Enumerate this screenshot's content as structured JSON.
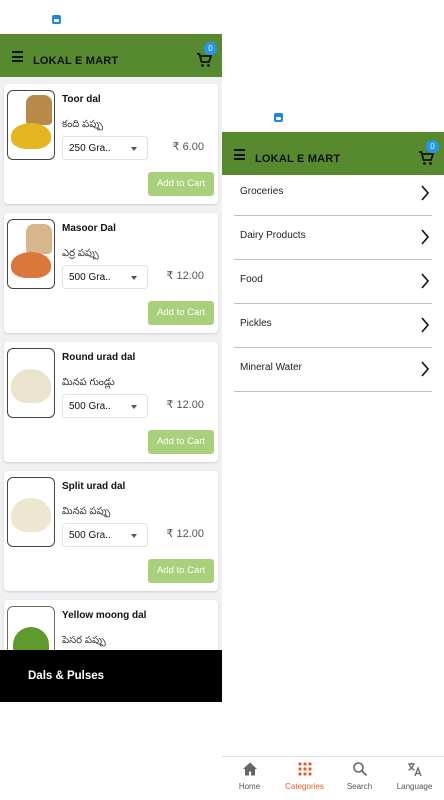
{
  "left_screen": {
    "app_title": "LOKAL E MART",
    "cart_count": "0",
    "products": [
      {
        "name": "Toor dal",
        "local_name": "కంది పప్పు",
        "quantity": "250 Gra..",
        "price": "₹ 6.00",
        "add_label": "Add to Cart",
        "image_color": "#e3b51e"
      },
      {
        "name": "Masoor Dal",
        "local_name": "ఎర్ర పప్పు",
        "quantity": "500 Gra..",
        "price": "₹ 12.00",
        "add_label": "Add to Cart",
        "image_color": "#d9783a"
      },
      {
        "name": "Round urad dal",
        "local_name": "మినప గుండ్లు",
        "quantity": "500 Gra..",
        "price": "₹ 12.00",
        "add_label": "Add to Cart",
        "image_color": "#ece3cf"
      },
      {
        "name": "Split urad dal",
        "local_name": "మినప పప్పు",
        "quantity": "500 Gra..",
        "price": "₹ 12.00",
        "add_label": "Add to Cart",
        "image_color": "#efe6d2"
      },
      {
        "name": "Yellow moong dal",
        "local_name": "పెసర పప్పు",
        "quantity": "",
        "price": "",
        "add_label": "",
        "image_color": "#5f9a2e"
      }
    ],
    "bottom_banner": "Dals & Pulses"
  },
  "right_screen": {
    "app_title": "LOKAL E MART",
    "cart_count": "0",
    "categories": [
      "Groceries",
      "Dairy Products",
      "Food",
      "Pickles",
      "Mineral Water"
    ],
    "nav": [
      {
        "label": "Home",
        "icon": "home-icon"
      },
      {
        "label": "Categories",
        "icon": "grid-icon"
      },
      {
        "label": "Search",
        "icon": "search-icon"
      },
      {
        "label": "Language",
        "icon": "translate-icon"
      }
    ],
    "active_nav": "Categories"
  },
  "colors": {
    "appbar": "#578a2f",
    "add_button": "#aad07c",
    "badge": "#2196f3",
    "active_nav": "#e65c2b"
  }
}
